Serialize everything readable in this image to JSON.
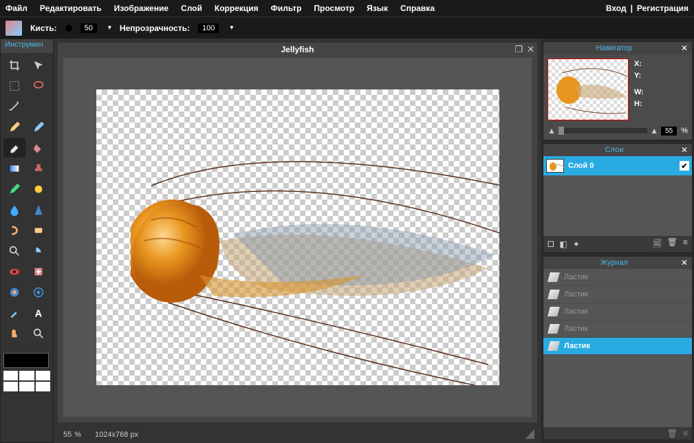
{
  "menu": {
    "items": [
      "Файл",
      "Редактировать",
      "Изображение",
      "Слой",
      "Коррекция",
      "Фильтр",
      "Просмотр",
      "Язык",
      "Справка"
    ],
    "login": "Вход",
    "sep": "|",
    "register": "Регистрация"
  },
  "options": {
    "brush_label": "Кисть:",
    "brush_value": "50",
    "opacity_label": "Непрозрачность:",
    "opacity_value": "100"
  },
  "toolbox": {
    "title": "Инструмен"
  },
  "canvas": {
    "title": "Jellyfish",
    "zoom": "55",
    "zoom_pct": "%",
    "dims": "1024x768 px"
  },
  "navigator": {
    "title": "Навигатор",
    "x": "X:",
    "y": "Y:",
    "w": "W:",
    "h": "H:",
    "zoom": "55",
    "pct": "%"
  },
  "layers": {
    "title": "Слои",
    "items": [
      {
        "name": "Слой 0",
        "visible": true
      }
    ]
  },
  "journal": {
    "title": "Журнал",
    "items": [
      "Ластик",
      "Ластик",
      "Ластик",
      "Ластик",
      "Ластик"
    ],
    "active_index": 4
  }
}
